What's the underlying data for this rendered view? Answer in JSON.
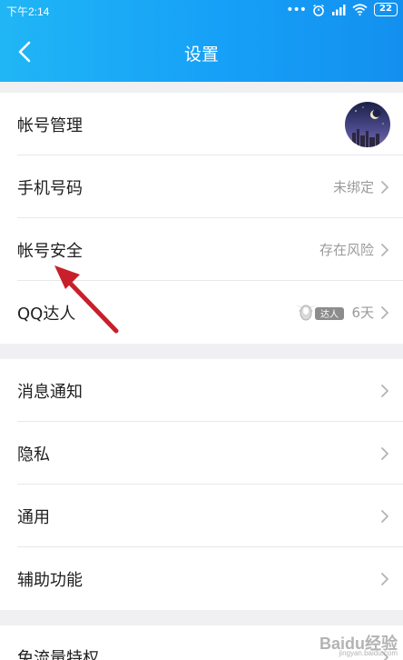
{
  "status_bar": {
    "time": "下午2:14",
    "battery": "22",
    "icons": [
      "more-dots-icon",
      "alarm-icon",
      "signal-icon",
      "wifi-icon",
      "battery-icon"
    ]
  },
  "nav": {
    "title": "设置",
    "back_icon": "back-chevron-icon"
  },
  "groups": [
    {
      "items": [
        {
          "label": "帐号管理",
          "value": "",
          "accessory": "avatar"
        },
        {
          "label": "手机号码",
          "value": "未绑定",
          "accessory": "chevron"
        },
        {
          "label": "帐号安全",
          "value": "存在风险",
          "accessory": "chevron"
        },
        {
          "label": "QQ达人",
          "value": "6天",
          "badge": "达人",
          "accessory": "chevron"
        }
      ]
    },
    {
      "items": [
        {
          "label": "消息通知",
          "value": "",
          "accessory": "chevron"
        },
        {
          "label": "隐私",
          "value": "",
          "accessory": "chevron"
        },
        {
          "label": "通用",
          "value": "",
          "accessory": "chevron"
        },
        {
          "label": "辅助功能",
          "value": "",
          "accessory": "chevron"
        }
      ]
    },
    {
      "items": [
        {
          "label": "免流量特权",
          "value": "",
          "accessory": "chevron"
        }
      ]
    }
  ],
  "annotation": {
    "type": "red-arrow",
    "target": "帐号安全",
    "color": "#c8202a"
  },
  "watermark": {
    "text": "Baidu经验",
    "sub": "jingyan.baidu.com"
  },
  "colors": {
    "header_start": "#20b6f5",
    "header_end": "#1390ef",
    "background": "#f0f0f3",
    "secondary_text": "#9a9a9a"
  }
}
